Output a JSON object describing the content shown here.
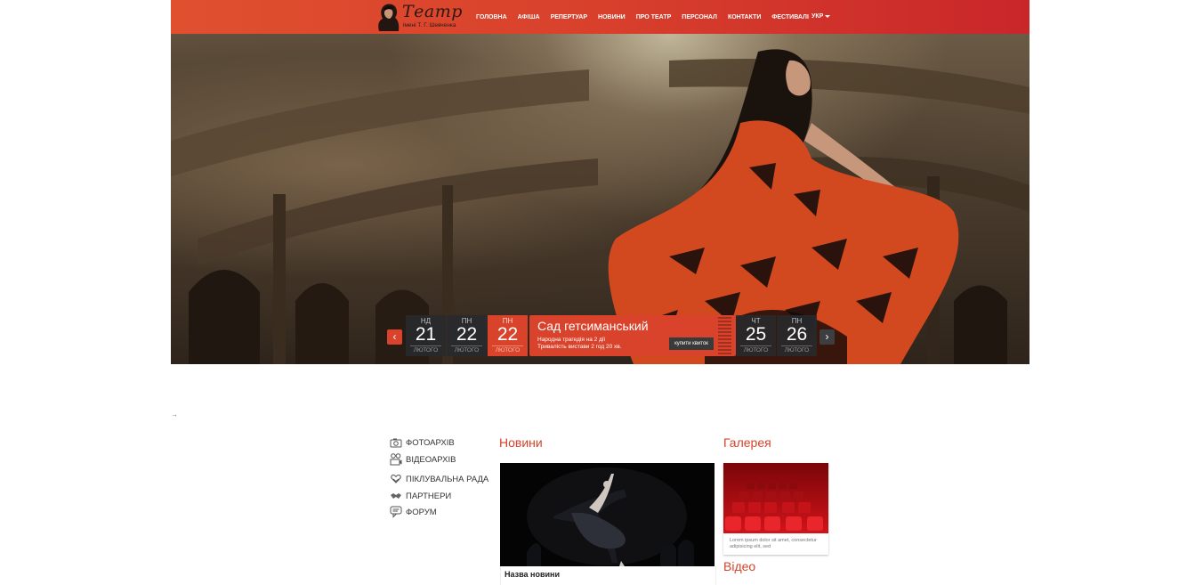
{
  "header": {
    "logo_title": "Театр",
    "logo_subtitle": "імені Т. Г. Шевченка",
    "nav": [
      "Головна",
      "Афіша",
      "Репертуар",
      "Новини",
      "Про театр",
      "Персонал",
      "Контакти",
      "Фестивалі"
    ],
    "lang": "УКР"
  },
  "calendar": {
    "prev_icon": "chevron-left-icon",
    "next_icon": "chevron-right-icon",
    "days": [
      {
        "dow": "нд",
        "num": "21",
        "mon": "лютого"
      },
      {
        "dow": "пн",
        "num": "22",
        "mon": "лютого"
      },
      {
        "dow": "пн",
        "num": "22",
        "mon": "лютого"
      },
      {
        "dow": "чт",
        "num": "25",
        "mon": "лютого"
      },
      {
        "dow": "пн",
        "num": "26",
        "mon": "лютого"
      }
    ],
    "event": {
      "title": "Сад гетсиманський",
      "desc1": "Народна трагедія на 2 дії",
      "desc2": "Тривалість вистави 2 год 20 хв.",
      "button": "купити квиток"
    }
  },
  "stray_arrow": "→",
  "sidebar": {
    "items": [
      {
        "label": "Фотоархів",
        "icon": "camera-icon"
      },
      {
        "label": "Відеоархів",
        "icon": "video-camera-icon"
      },
      {
        "label": "Піклувальна рада",
        "icon": "heart-hand-icon"
      },
      {
        "label": "Партнери",
        "icon": "handshake-icon"
      },
      {
        "label": "Форум",
        "icon": "chat-icon"
      }
    ]
  },
  "news": {
    "title": "Новини",
    "item_caption": "Назва новини"
  },
  "gallery": {
    "title": "Галерея",
    "text": "Lorem ipsum dolor sit amet, consectetur adipisicing elit, sed"
  },
  "video": {
    "title": "Відео"
  },
  "colors": {
    "accent": "#d9432b",
    "header_end": "#c9262a",
    "dark": "#3c3e42"
  }
}
